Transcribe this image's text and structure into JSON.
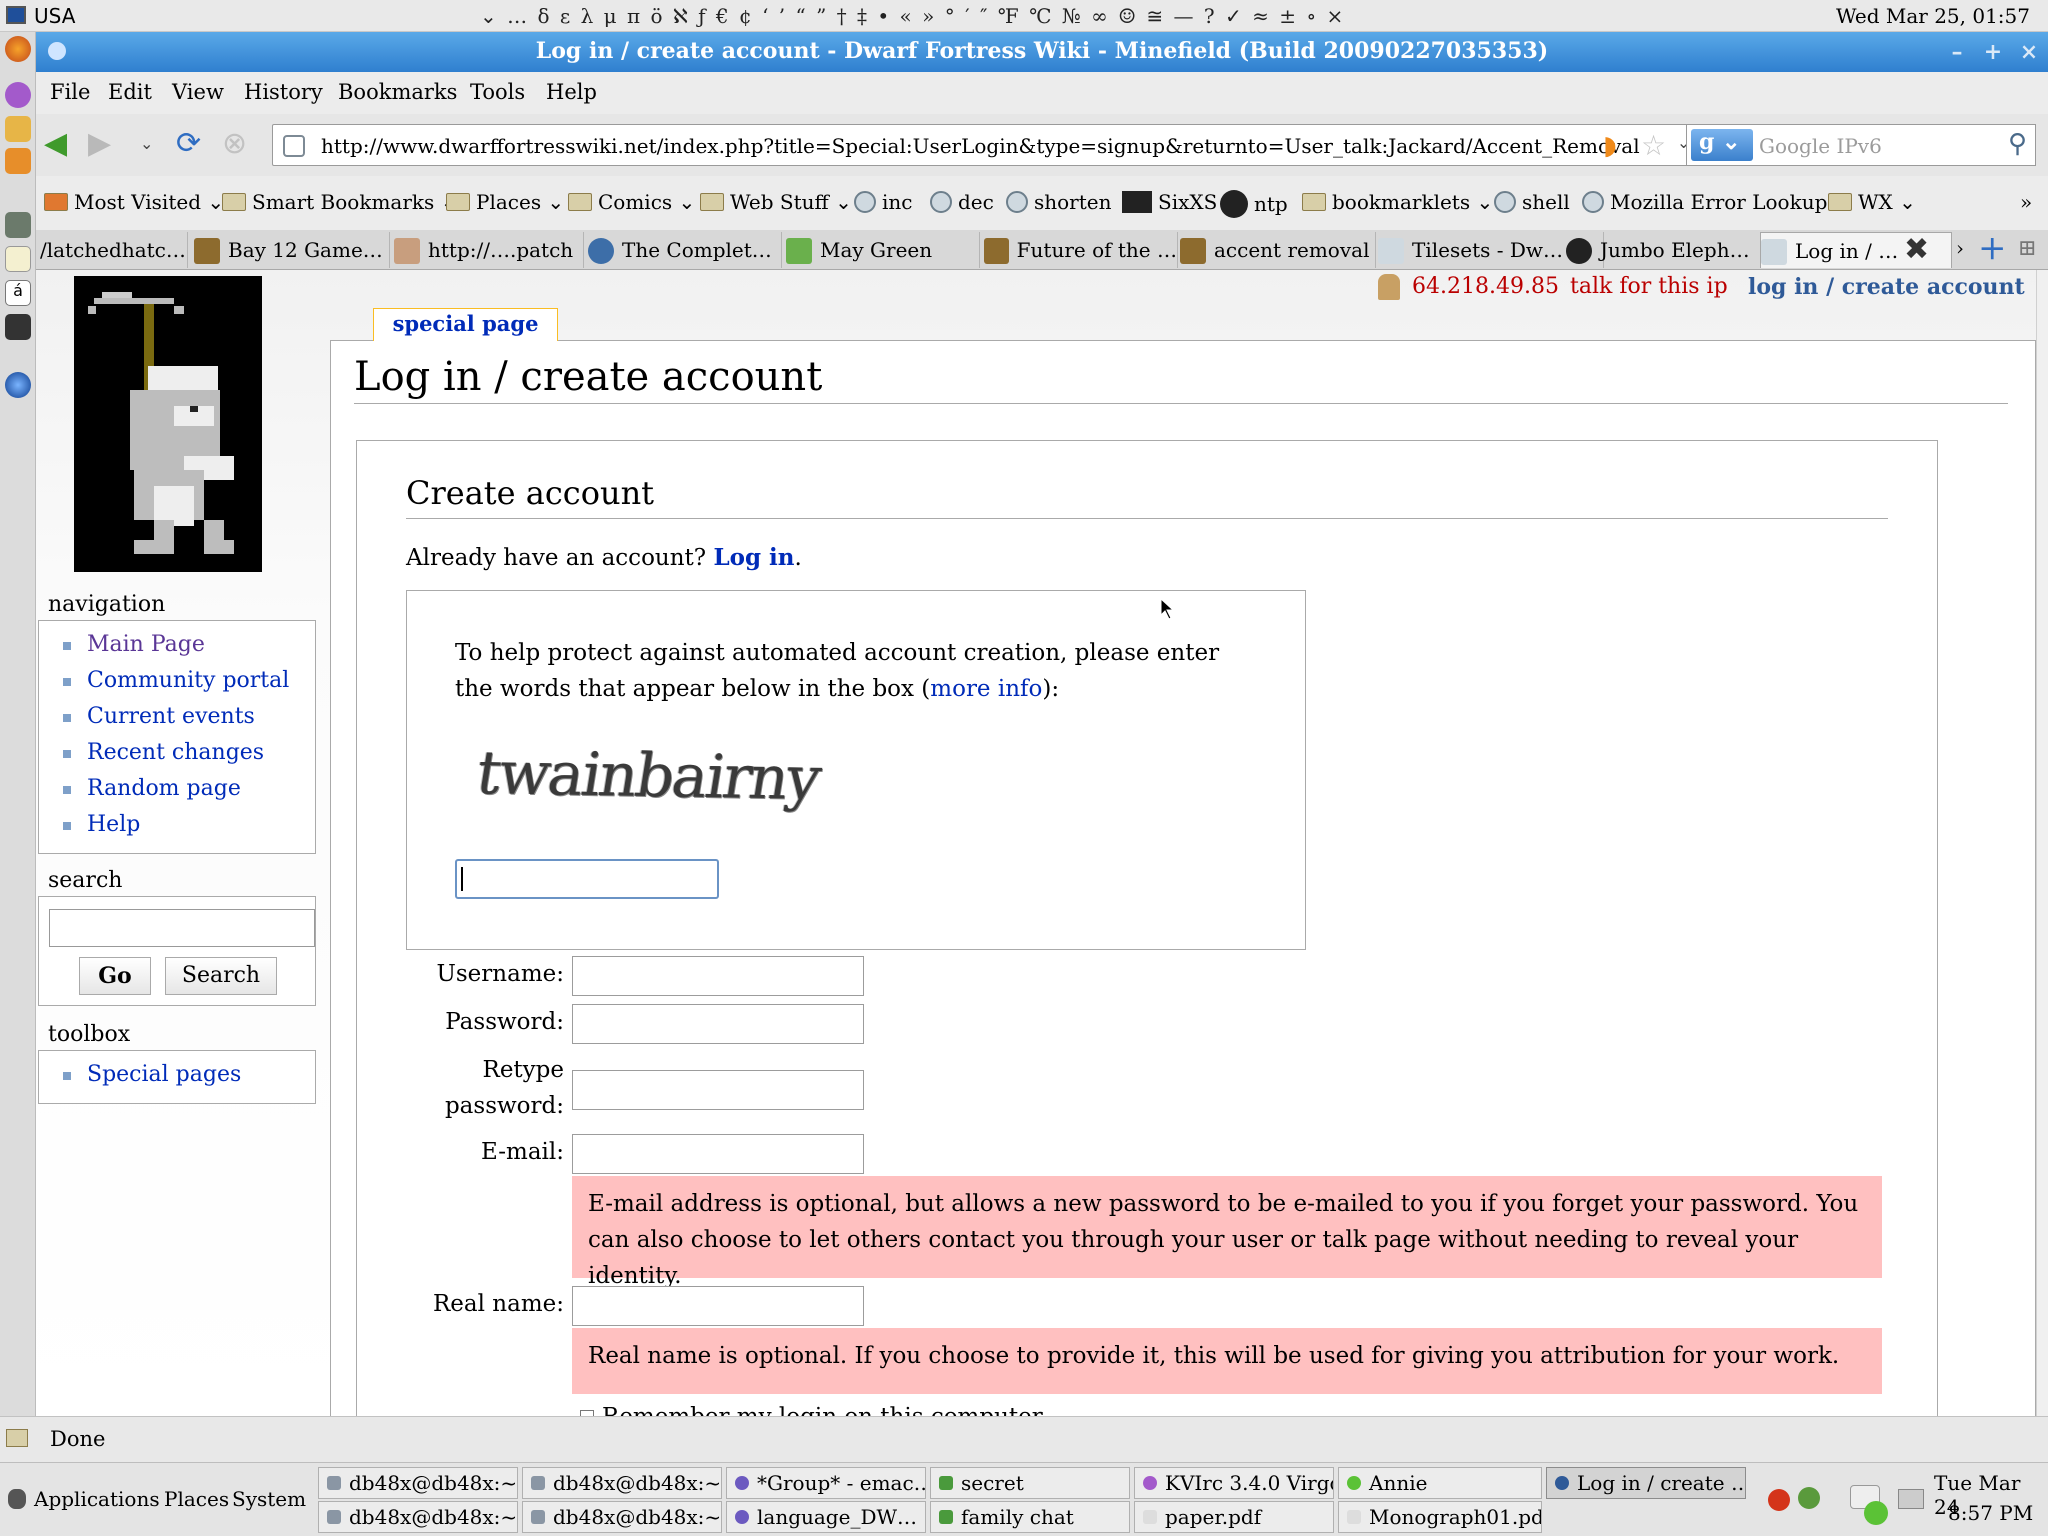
{
  "system_panel": {
    "keyboard_layout": "USA",
    "special_chars": "⌄ … δ ε λ μ π ö ℵ ƒ € ¢ ‘ ’ “ ” † ‡ • « » ° ′ ″ ℉ ℃ № ∞ ☺ ≅ — ? ✓ ≈ ± ∘ ×",
    "clock": "Wed Mar 25, 01:57"
  },
  "window": {
    "title": "Log in / create account - Dwarf Fortress Wiki - Minefield (Build 20090227035353)"
  },
  "menu": {
    "file": "File",
    "edit": "Edit",
    "view": "View",
    "history": "History",
    "bookmarks": "Bookmarks",
    "tools": "Tools",
    "help": "Help"
  },
  "navigation_bar": {
    "url": "http://www.dwarffortresswiki.net/index.php?title=Special:UserLogin&type=signup&returnto=User_talk:Jackard/Accent_Removal",
    "search_placeholder": "Google IPv6",
    "search_engine_icon": "g-icon"
  },
  "bookmarks": [
    {
      "label": "Most Visited ⌄",
      "icon": "folder"
    },
    {
      "label": "Smart Bookmarks ⌄",
      "icon": "folder"
    },
    {
      "label": "Places ⌄",
      "icon": "folder"
    },
    {
      "label": "Comics ⌄",
      "icon": "folder"
    },
    {
      "label": "Web Stuff ⌄",
      "icon": "folder"
    },
    {
      "label": "inc",
      "icon": "globe"
    },
    {
      "label": "dec",
      "icon": "globe"
    },
    {
      "label": "shorten",
      "icon": "globe"
    },
    {
      "label": "SixXS",
      "icon": "sixxs"
    },
    {
      "label": "ntp",
      "icon": "clock"
    },
    {
      "label": "bookmarklets ⌄",
      "icon": "folder"
    },
    {
      "label": "shell",
      "icon": "globe"
    },
    {
      "label": "Mozilla Error Lookup",
      "icon": "globe"
    },
    {
      "label": "WX ⌄",
      "icon": "folder"
    }
  ],
  "tabs": [
    {
      "label": "/latchedhatc…"
    },
    {
      "label": "Bay 12 Game…"
    },
    {
      "label": "http://….patch"
    },
    {
      "label": "The Complet…"
    },
    {
      "label": "May Green"
    },
    {
      "label": "Future of the …"
    },
    {
      "label": "accent removal"
    },
    {
      "label": "Tilesets - Dw…"
    },
    {
      "label": "Jumbo Eleph…"
    },
    {
      "label": "Log in / …",
      "active": true
    }
  ],
  "wiki": {
    "special_tab": "special page",
    "user_ip": "64.218.49.85",
    "talk_link": "talk for this ip",
    "login_link": "log in / create account",
    "page_title": "Log in / create account",
    "navigation_heading": "navigation",
    "navigation": [
      "Main Page",
      "Community portal",
      "Current events",
      "Recent changes",
      "Random page",
      "Help"
    ],
    "search_heading": "search",
    "go_button": "Go",
    "search_button": "Search",
    "toolbox_heading": "toolbox",
    "toolbox": [
      "Special pages"
    ],
    "form": {
      "heading": "Create account",
      "already_text": "Already have an account?",
      "login_link": "Log in",
      "period": ".",
      "captcha_text_before": "To help protect against automated account creation, please enter the words that appear below in the box (",
      "captcha_more_info": "more info",
      "captcha_text_after": "):",
      "captcha_word": "twainbairny",
      "username_label": "Username:",
      "password_label": "Password:",
      "retype_label_1": "Retype",
      "retype_label_2": "password:",
      "email_label": "E-mail:",
      "email_notice": "E-mail address is optional, but allows a new password to be e-mailed to you if you forget your password. You can also choose to let others contact you through your user or talk page without needing to reveal your identity.",
      "realname_label": "Real name:",
      "realname_notice": "Real name is optional. If you choose to provide it, this will be used for giving you attribution for your work.",
      "remember_label": "Remember my login on this computer"
    }
  },
  "status": "Done",
  "bottom_panel": {
    "applications": "Applications",
    "places": "Places",
    "system": "System",
    "tasks": [
      "db48x@db48x:~…",
      "db48x@db48x:~…",
      "*Group* - emac…",
      "secret",
      "KVIrc 3.4.0 Virgo",
      "Annie",
      "Log in / create …",
      "db48x@db48x:~…",
      "db48x@db48x:~…",
      "language_DW…",
      "family chat",
      "paper.pdf",
      "Monograph01.pdf"
    ],
    "date": "Tue Mar 24",
    "time": "8:57 PM"
  },
  "colors": {
    "title_bar": "#2f7fcf",
    "link": "#002bb8",
    "notice_bg": "#ffc0c0",
    "ip_red": "#ba0000"
  }
}
